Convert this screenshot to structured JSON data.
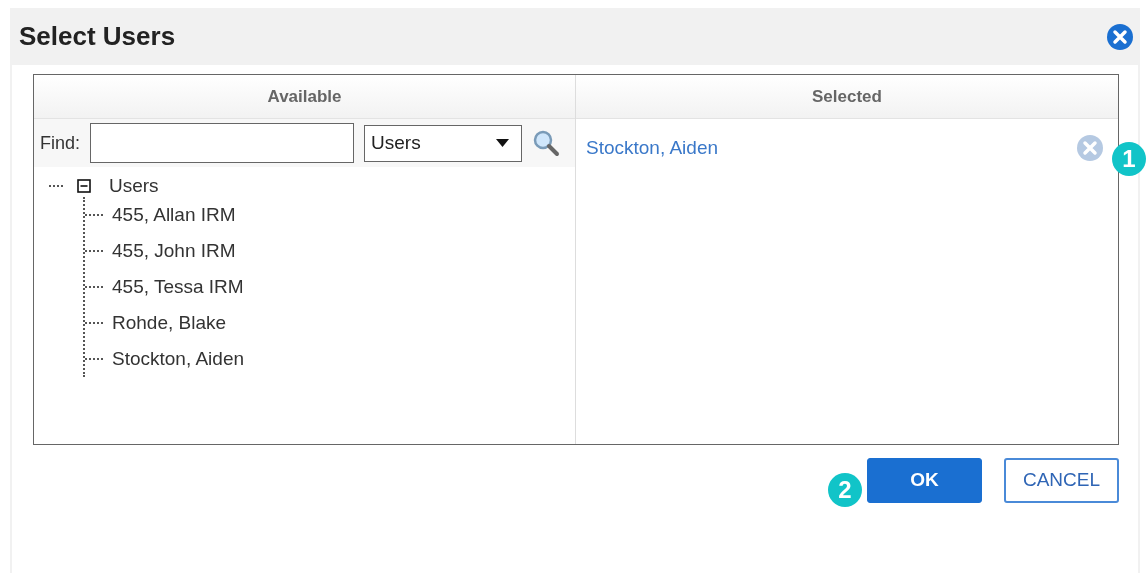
{
  "window": {
    "title": "Select Users"
  },
  "available": {
    "heading": "Available",
    "find_label": "Find:",
    "type_select": "Users",
    "tree": [
      {
        "label": "Users",
        "expanded": true,
        "children": [
          {
            "label": "455, Allan IRM"
          },
          {
            "label": "455, John IRM"
          },
          {
            "label": "455, Tessa IRM"
          },
          {
            "label": "Rohde, Blake"
          },
          {
            "label": "Stockton, Aiden"
          }
        ]
      }
    ]
  },
  "selected": {
    "heading": "Selected",
    "items": [
      {
        "label": "Stockton, Aiden"
      }
    ]
  },
  "buttons": [
    {
      "label": "OK",
      "kind": "primary"
    },
    {
      "label": "CANCEL",
      "kind": "secondary"
    }
  ],
  "callouts": [
    {
      "text": "1"
    },
    {
      "text": "2"
    }
  ]
}
